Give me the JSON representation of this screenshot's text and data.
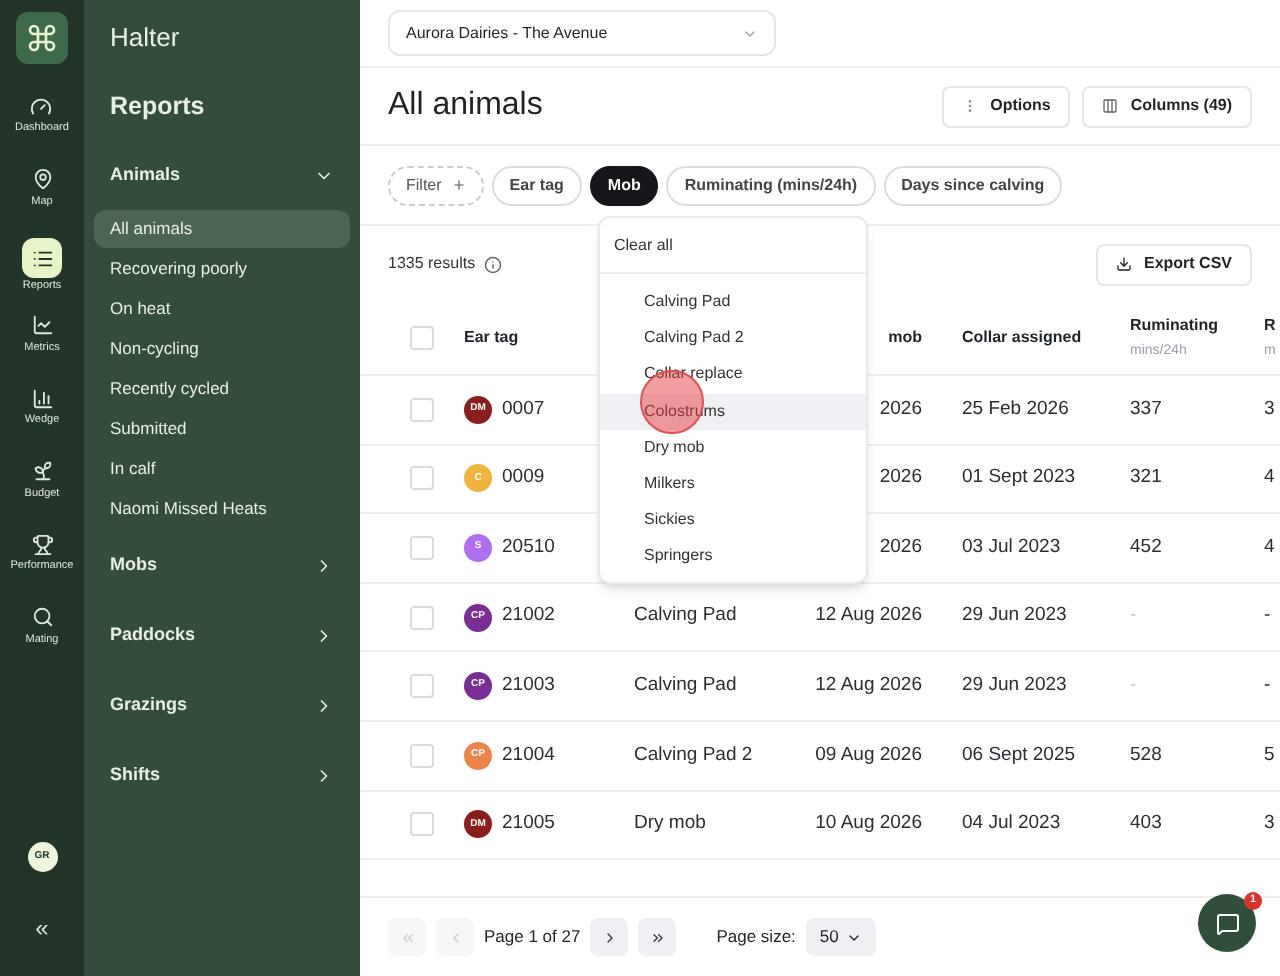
{
  "rail": {
    "items": [
      {
        "label": "Dashboard",
        "selected": false
      },
      {
        "label": "Map",
        "selected": false
      },
      {
        "label": "Reports",
        "selected": true
      },
      {
        "label": "Metrics",
        "selected": false
      },
      {
        "label": "Wedge",
        "selected": false
      },
      {
        "label": "Budget",
        "selected": false
      },
      {
        "label": "Performance",
        "selected": false
      },
      {
        "label": "Mating",
        "selected": false
      }
    ],
    "avatar": "GR",
    "collapse": "«"
  },
  "sidebar": {
    "brand": "Halter",
    "title": "Reports",
    "sections": [
      {
        "label": "Animals",
        "expanded": true,
        "items": [
          {
            "label": "All animals",
            "selected": true
          },
          {
            "label": "Recovering poorly",
            "selected": false
          },
          {
            "label": "On heat",
            "selected": false
          },
          {
            "label": "Non-cycling",
            "selected": false
          },
          {
            "label": "Recently cycled",
            "selected": false
          },
          {
            "label": "Submitted",
            "selected": false
          },
          {
            "label": "In calf",
            "selected": false
          },
          {
            "label": "Naomi Missed Heats",
            "selected": false
          }
        ]
      },
      {
        "label": "Mobs",
        "expanded": false
      },
      {
        "label": "Paddocks",
        "expanded": false
      },
      {
        "label": "Grazings",
        "expanded": false
      },
      {
        "label": "Shifts",
        "expanded": false
      }
    ]
  },
  "farm_select": "Aurora Dairies - The Avenue",
  "page_title": "All animals",
  "options_button": "Options",
  "columns_button": "Columns (49)",
  "filters": [
    {
      "label": "Filter",
      "kind": "add"
    },
    {
      "label": "Ear tag",
      "kind": "chip",
      "selected": false
    },
    {
      "label": "Mob",
      "kind": "chip",
      "selected": true
    },
    {
      "label": "Ruminating (mins/24h)",
      "kind": "chip",
      "selected": false
    },
    {
      "label": "Days since calving",
      "kind": "chip",
      "selected": false
    }
  ],
  "results": "1335 results",
  "export_button": "Export CSV",
  "mob_dropdown": {
    "clear": "Clear all",
    "items": [
      {
        "label": "Calving Pad",
        "selected": false
      },
      {
        "label": "Calving Pad 2",
        "selected": false
      },
      {
        "label": "Collar replace",
        "selected": false
      },
      {
        "label": "Colostrums",
        "selected": true
      },
      {
        "label": "Dry mob",
        "selected": false
      },
      {
        "label": "Milkers",
        "selected": false
      },
      {
        "label": "Sickies",
        "selected": false
      },
      {
        "label": "Springers",
        "selected": false
      }
    ]
  },
  "table": {
    "header_checked": false,
    "columns": {
      "ear_tag": "Ear tag",
      "date": "mob",
      "collar": "Collar assigned",
      "ruminating": {
        "label": "Ruminating",
        "unit": "mins/24h"
      },
      "column_6": {
        "label": "R",
        "unit": "m"
      }
    },
    "rows": [
      {
        "checked": false,
        "badge": "DM",
        "color": "#8b1d1d",
        "tag": "0007",
        "date": "2026",
        "collar": "25 Feb 2026",
        "ruminating": "337",
        "column_6": "3"
      },
      {
        "checked": false,
        "badge": "C",
        "color": "#f0b43c",
        "tag": "0009",
        "date": "2026",
        "collar": "01 Sept 2023",
        "ruminating": "321",
        "column_6": "4"
      },
      {
        "checked": false,
        "badge": "S",
        "color": "#b06ef0",
        "tag": "20510",
        "date": "2026",
        "collar": "03 Jul 2023",
        "ruminating": "452",
        "column_6": "4"
      },
      {
        "checked": false,
        "badge": "CP",
        "color": "#7b2d96",
        "tag": "21002",
        "mob": "Calving Pad",
        "date": "12 Aug 2026",
        "collar": "29 Jun 2023",
        "ruminating": "-",
        "column_6": "-"
      },
      {
        "checked": false,
        "badge": "CP",
        "color": "#7b2d96",
        "tag": "21003",
        "mob": "Calving Pad",
        "date": "12 Aug 2026",
        "collar": "29 Jun 2023",
        "ruminating": "-",
        "column_6": "-"
      },
      {
        "checked": false,
        "badge": "CP",
        "color": "#ec8449",
        "tag": "21004",
        "mob": "Calving Pad 2",
        "date": "09 Aug 2026",
        "collar": "06 Sept 2025",
        "ruminating": "528",
        "column_6": "5"
      },
      {
        "checked": false,
        "badge": "DM",
        "color": "#8b1d1d",
        "tag": "21005",
        "mob": "Dry mob",
        "date": "10 Aug 2026",
        "collar": "04 Jul 2023",
        "ruminating": "403",
        "column_6": "3"
      }
    ]
  },
  "pagination": {
    "first_disabled": true,
    "prev_disabled": true,
    "next_disabled": false,
    "last_disabled": false,
    "page": "Page 1 of 27",
    "size_label": "Page size:",
    "size": "50"
  },
  "chat": {
    "badge": "1"
  }
}
